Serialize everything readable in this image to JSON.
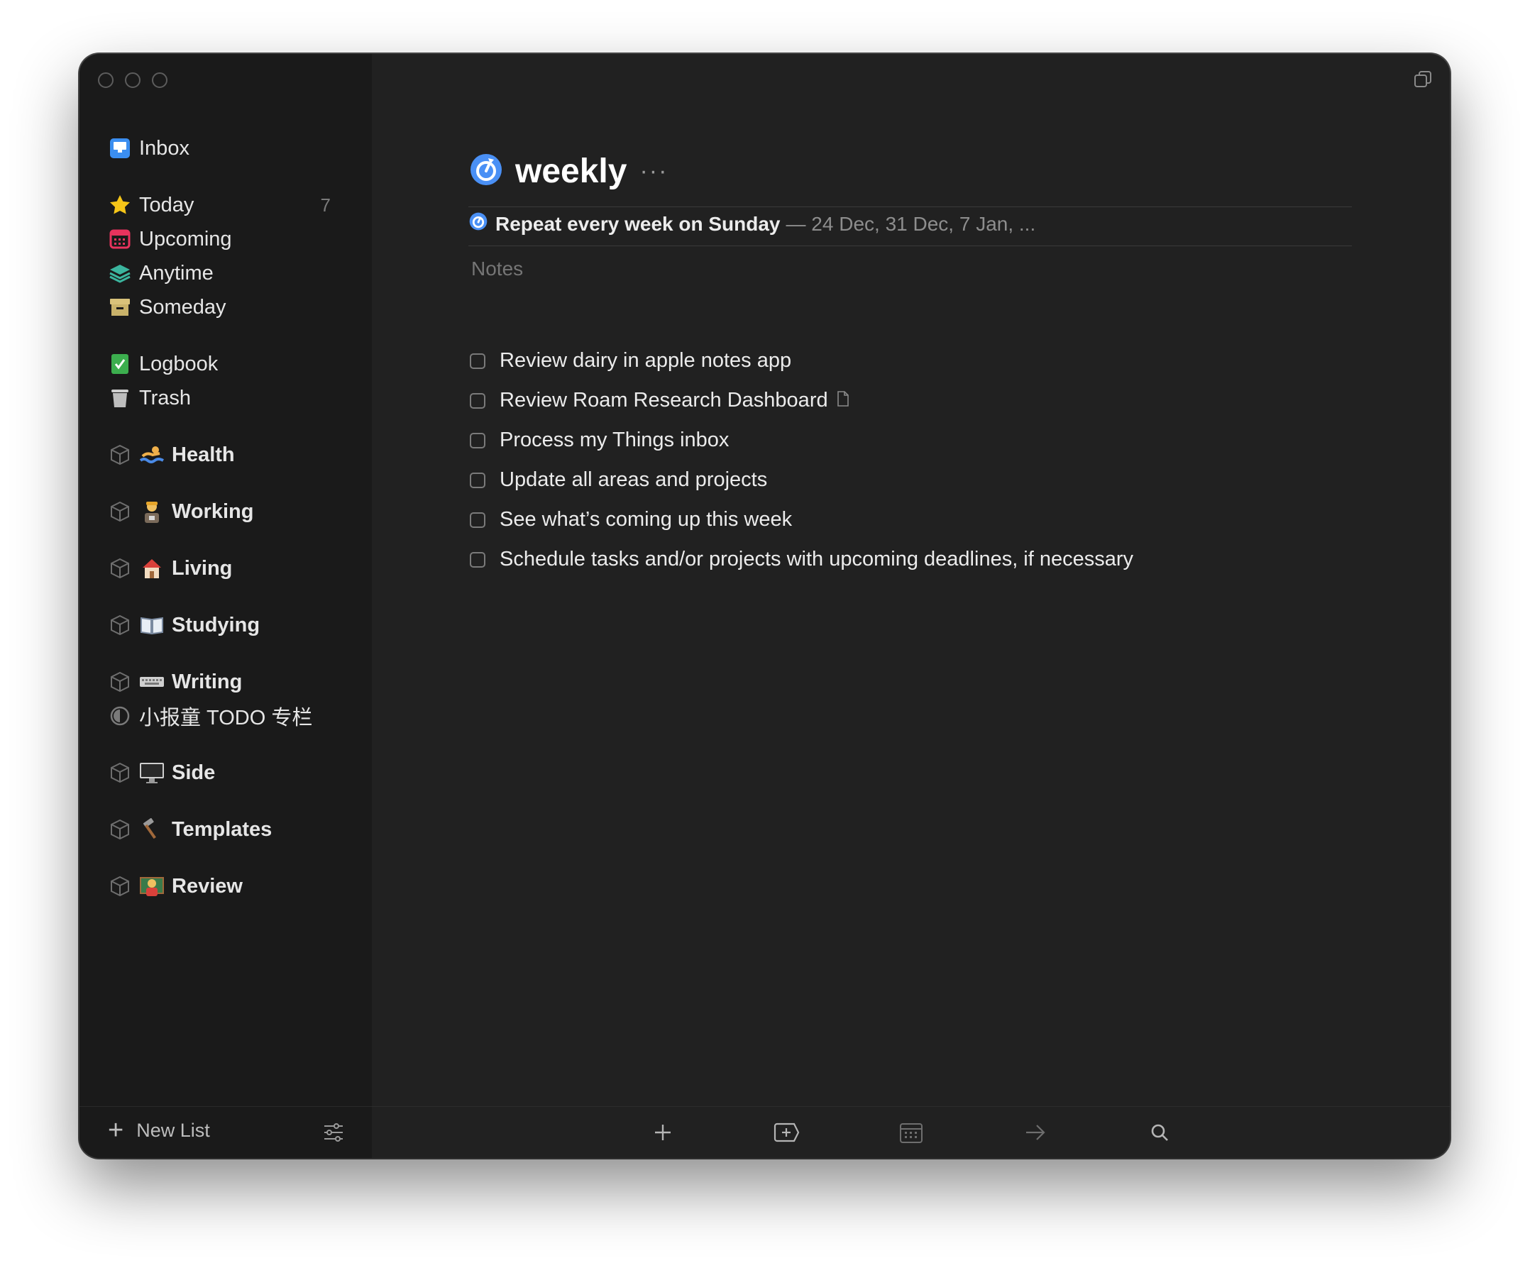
{
  "sidebar": {
    "inbox": {
      "label": "Inbox"
    },
    "today": {
      "label": "Today",
      "count": "7"
    },
    "upcoming": {
      "label": "Upcoming"
    },
    "anytime": {
      "label": "Anytime"
    },
    "someday": {
      "label": "Someday"
    },
    "logbook": {
      "label": "Logbook"
    },
    "trash": {
      "label": "Trash"
    },
    "areas": [
      {
        "label": "Health",
        "emoji": "swimmer-emoji"
      },
      {
        "label": "Working",
        "emoji": "worker-emoji"
      },
      {
        "label": "Living",
        "emoji": "house-emoji"
      },
      {
        "label": "Studying",
        "emoji": "book-emoji"
      },
      {
        "label": "Writing",
        "emoji": "keyboard-emoji"
      },
      {
        "label": "Side",
        "emoji": "monitor-emoji"
      },
      {
        "label": "Templates",
        "emoji": "hammer-emoji"
      },
      {
        "label": "Review",
        "emoji": "teacher-emoji"
      }
    ],
    "project": {
      "label": "小报童 TODO 专栏"
    },
    "footer": {
      "new_list": "New List"
    }
  },
  "main": {
    "title": "weekly",
    "more": "···",
    "repeat": {
      "rule": "Repeat every week on Sunday",
      "dates": "— 24 Dec, 31 Dec, 7 Jan, ..."
    },
    "notes_placeholder": "Notes",
    "tasks": [
      {
        "label": "Review dairy in apple notes app",
        "has_note": false
      },
      {
        "label": "Review Roam Research Dashboard",
        "has_note": true
      },
      {
        "label": "Process my Things inbox",
        "has_note": false
      },
      {
        "label": "Update all areas and projects",
        "has_note": false
      },
      {
        "label": "See what’s coming up this week",
        "has_note": false
      },
      {
        "label": "Schedule tasks and/or projects with upcoming deadlines, if necessary",
        "has_note": false
      }
    ]
  },
  "colors": {
    "accent_blue": "#4a90f5",
    "today_star": "#f5c518",
    "upcoming_red": "#e8335d",
    "anytime_teal": "#3bb59e",
    "someday_tan": "#d9c27a",
    "logbook_green": "#3cae4e"
  }
}
